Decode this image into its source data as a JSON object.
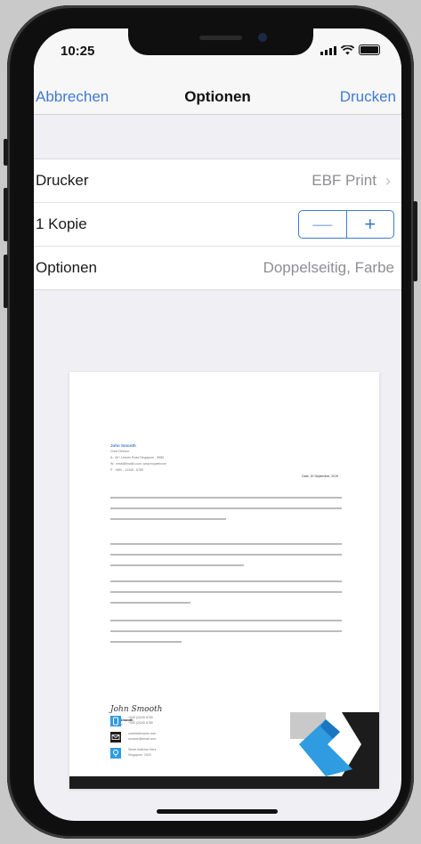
{
  "status_bar": {
    "time": "10:25"
  },
  "nav": {
    "cancel": "Abbrechen",
    "title": "Optionen",
    "print": "Drucken"
  },
  "settings": {
    "printer": {
      "label": "Drucker",
      "value": "EBF Print"
    },
    "copies": {
      "label": "1 Kopie",
      "minus": "—",
      "plus": "+"
    },
    "options": {
      "label": "Optionen",
      "value": "Doppelseitig, Farbe"
    }
  },
  "preview": {
    "sender_name": "John Smooth",
    "sender_role": "Chief Director",
    "address_lines": [
      "A : 45 / Lincoln Road Singapore - 8989",
      "W : email@mailid.com, www.mywebcom",
      "P : +880 - 12345 - 6789"
    ],
    "date": "Date, 10 September, 2019",
    "signature": "John Smooth",
    "signature_name": "John Smooth",
    "signature_role": "Manager",
    "contacts": [
      {
        "icon": "phone-icon",
        "lines": [
          "+000 (2)345 6789",
          "+000 (2)345 6789"
        ]
      },
      {
        "icon": "email-icon",
        "lines": [
          "urwebsitename.com",
          "urname@email.com"
        ]
      },
      {
        "icon": "location-icon",
        "lines": [
          "Street Address Here",
          "Singapore, 2020"
        ]
      }
    ]
  },
  "colors": {
    "accent": "#3f7ad0",
    "letterhead_blue": "#2f9be0"
  }
}
